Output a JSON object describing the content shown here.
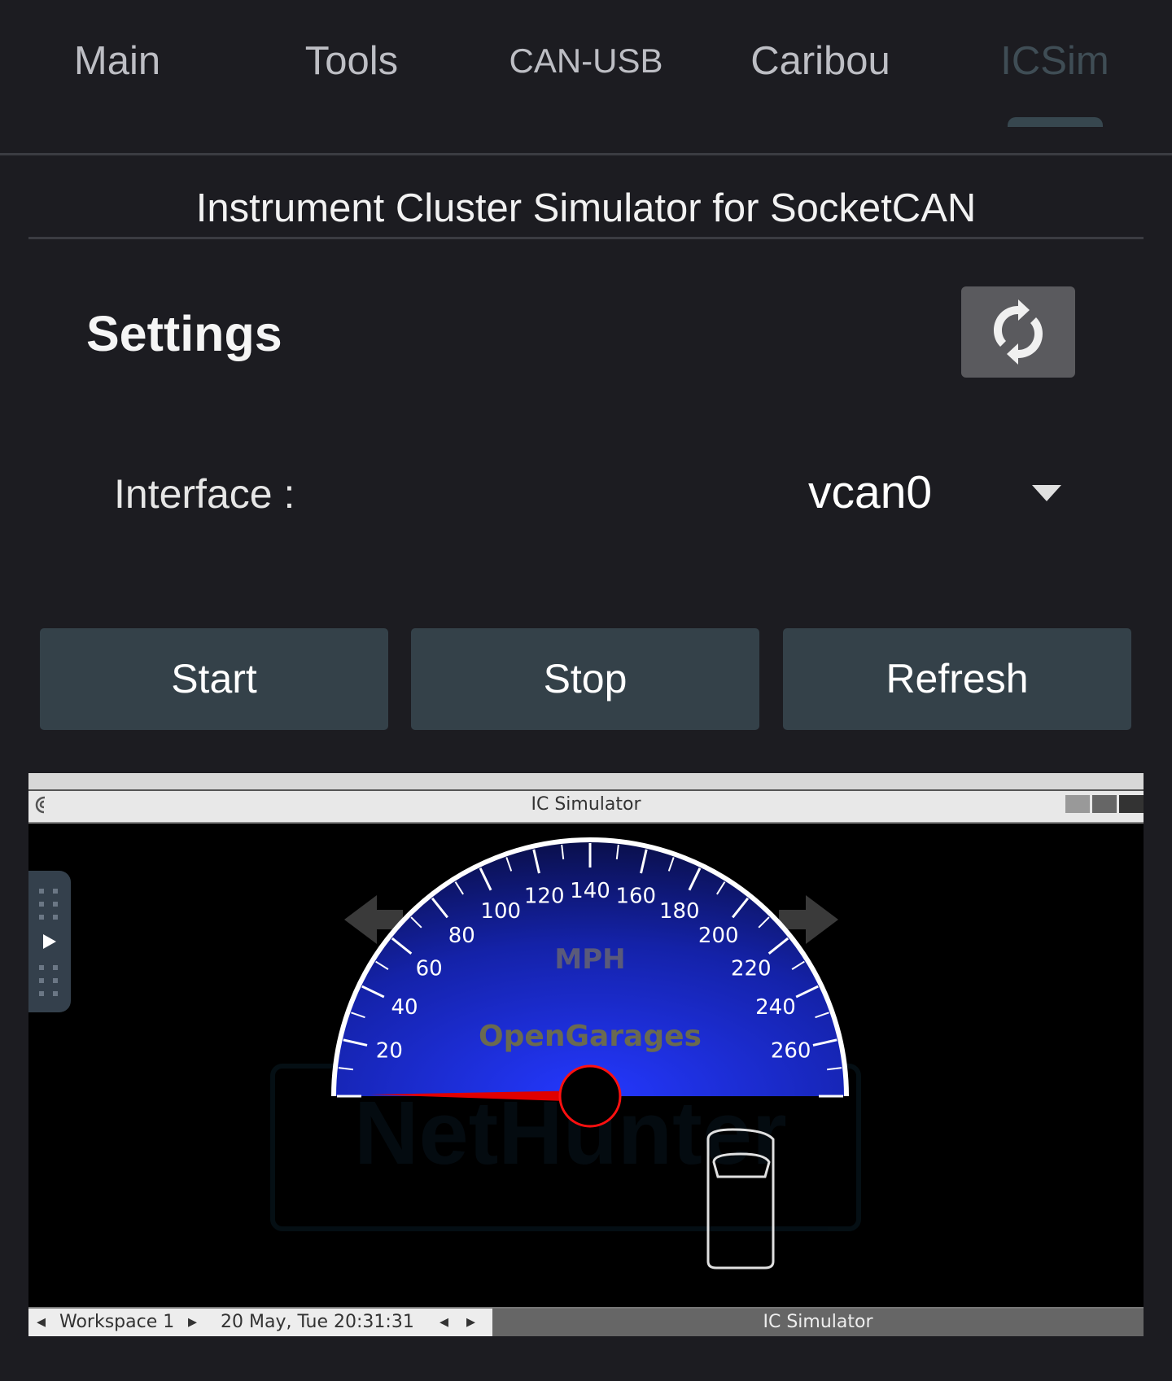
{
  "tabs": [
    {
      "label": "Main"
    },
    {
      "label": "Tools"
    },
    {
      "label": "CAN-USB"
    },
    {
      "label": "Caribou"
    },
    {
      "label": "ICSim"
    }
  ],
  "active_tab": "ICSim",
  "subtitle": "Instrument Cluster Simulator for SocketCAN",
  "settings": {
    "title": "Settings",
    "sync_icon": "sync-icon",
    "interface_label": "Interface :",
    "interface_value": "vcan0"
  },
  "buttons": {
    "start": "Start",
    "stop": "Stop",
    "refresh": "Refresh"
  },
  "vnc": {
    "window_title": "IC Simulator",
    "gauge": {
      "unit": "MPH",
      "brand": "OpenGarages",
      "ticks": [
        "20",
        "40",
        "60",
        "80",
        "100",
        "120",
        "140",
        "160",
        "180",
        "200",
        "220",
        "240",
        "260"
      ],
      "speed": 0
    },
    "watermark": "NetHunter",
    "taskbar": {
      "workspace": "Workspace 1",
      "datetime": "20 May, Tue 20:31:31",
      "window": "IC Simulator"
    }
  },
  "colors": {
    "background": "#1c1c21",
    "button": "#344149",
    "active_tab": "#3f4d55",
    "gauge_blue": "#1a2cff",
    "needle": "#ff0000"
  }
}
